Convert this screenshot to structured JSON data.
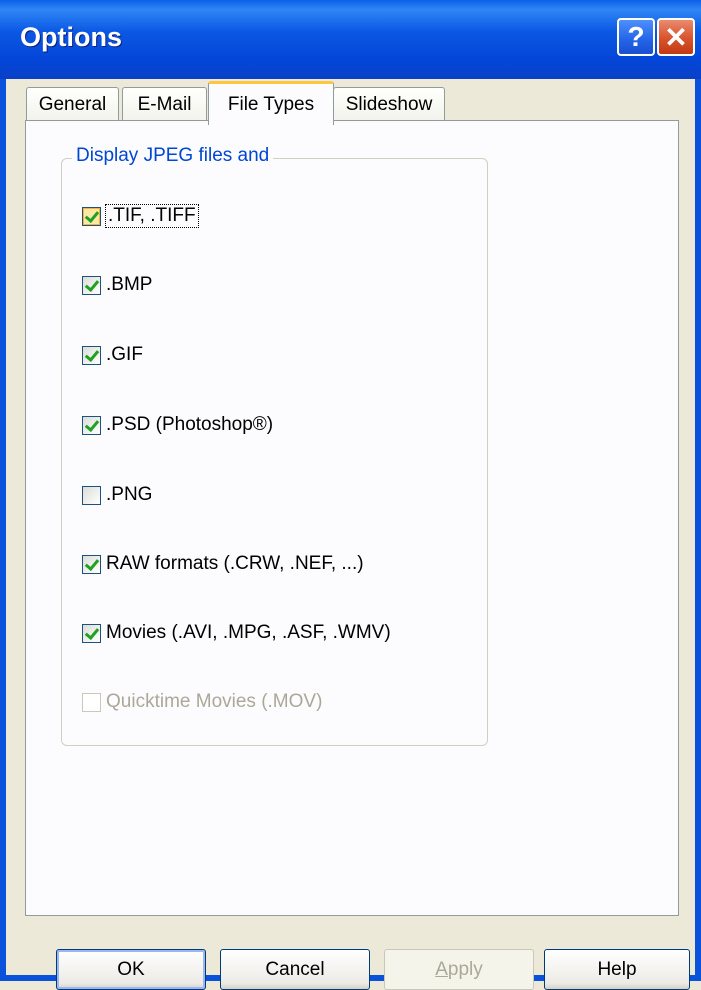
{
  "window": {
    "title": "Options",
    "help_glyph": "?",
    "close_glyph": "✕"
  },
  "tabs": [
    {
      "label": "General",
      "active": false
    },
    {
      "label": "E-Mail",
      "active": false
    },
    {
      "label": "File Types",
      "active": true
    },
    {
      "label": "Slideshow",
      "active": false
    }
  ],
  "group": {
    "title": "Display JPEG files and",
    "options": [
      {
        "label": ".TIF, .TIFF",
        "checked": true,
        "disabled": false,
        "focused": true
      },
      {
        "label": ".BMP",
        "checked": true,
        "disabled": false,
        "focused": false
      },
      {
        "label": ".GIF",
        "checked": true,
        "disabled": false,
        "focused": false
      },
      {
        "label": ".PSD (Photoshop®)",
        "checked": true,
        "disabled": false,
        "focused": false
      },
      {
        "label": ".PNG",
        "checked": false,
        "disabled": false,
        "focused": false
      },
      {
        "label": "RAW formats (.CRW, .NEF, ...)",
        "checked": true,
        "disabled": false,
        "focused": false
      },
      {
        "label": "Movies (.AVI, .MPG, .ASF, .WMV)",
        "checked": true,
        "disabled": false,
        "focused": false
      },
      {
        "label": "Quicktime Movies (.MOV)",
        "checked": false,
        "disabled": true,
        "focused": false
      }
    ]
  },
  "buttons": {
    "ok": "OK",
    "cancel": "Cancel",
    "apply_accel": "A",
    "apply_rest": "pply",
    "help": "Help"
  }
}
